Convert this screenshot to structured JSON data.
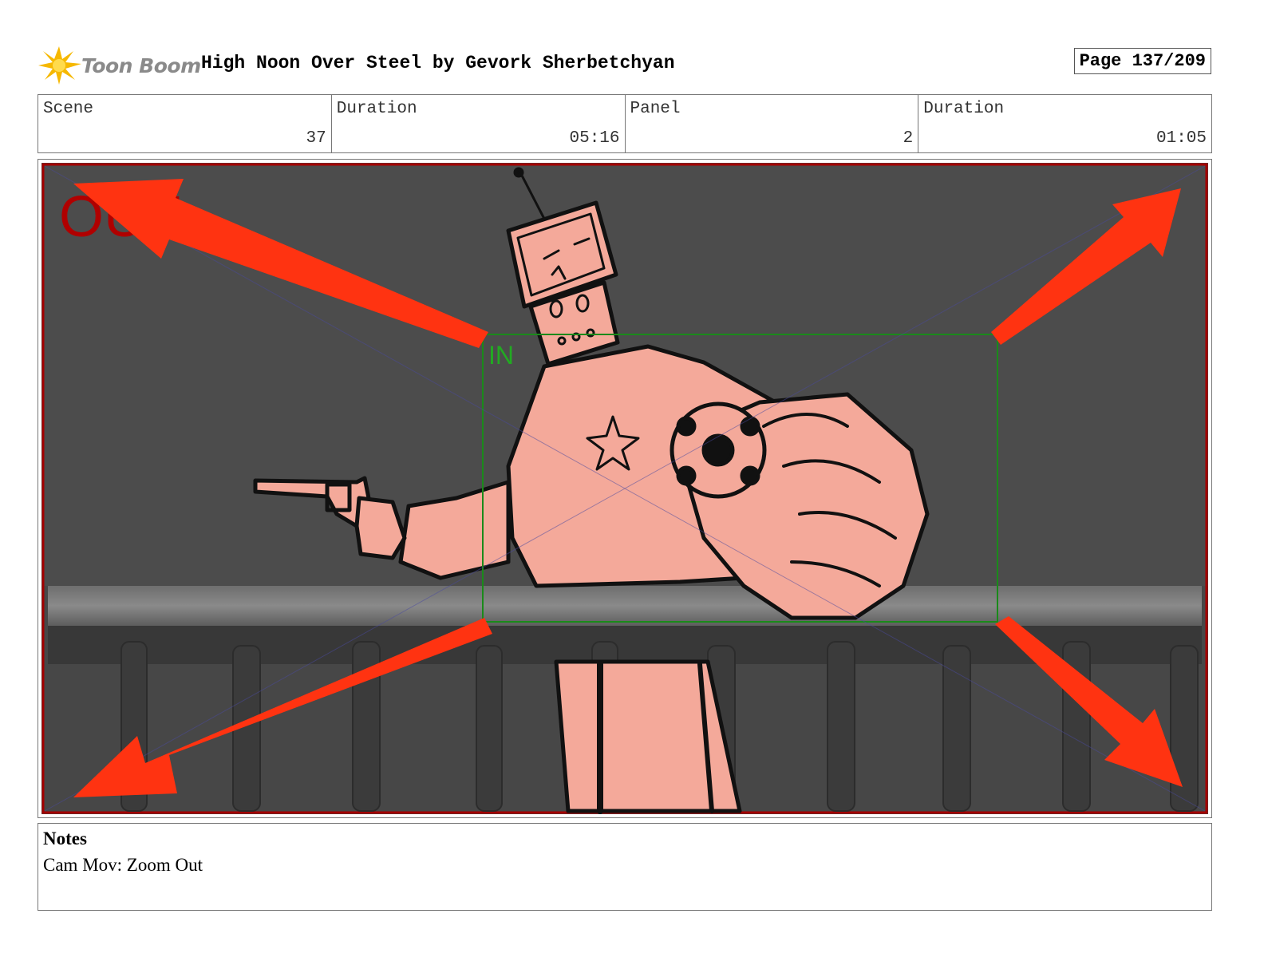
{
  "header": {
    "logo_text": "Toon Boom",
    "title": "High Noon Over Steel by Gevork Sherbetchyan",
    "page": "Page 137/209"
  },
  "info": {
    "scene_label": "Scene",
    "scene_value": "37",
    "scene_duration_label": "Duration",
    "scene_duration_value": "05:16",
    "panel_label": "Panel",
    "panel_value": "2",
    "panel_duration_label": "Duration",
    "panel_duration_value": "01:05"
  },
  "panel": {
    "out_label": "OUT",
    "in_label": "IN",
    "colors": {
      "arrow": "#ff3311",
      "out_label": "#b00000",
      "in_frame": "#1a8a1a",
      "figure_fill": "#f4a99a",
      "background": "#4a4a4a"
    }
  },
  "notes": {
    "title": "Notes",
    "text": "Cam Mov: Zoom Out"
  }
}
